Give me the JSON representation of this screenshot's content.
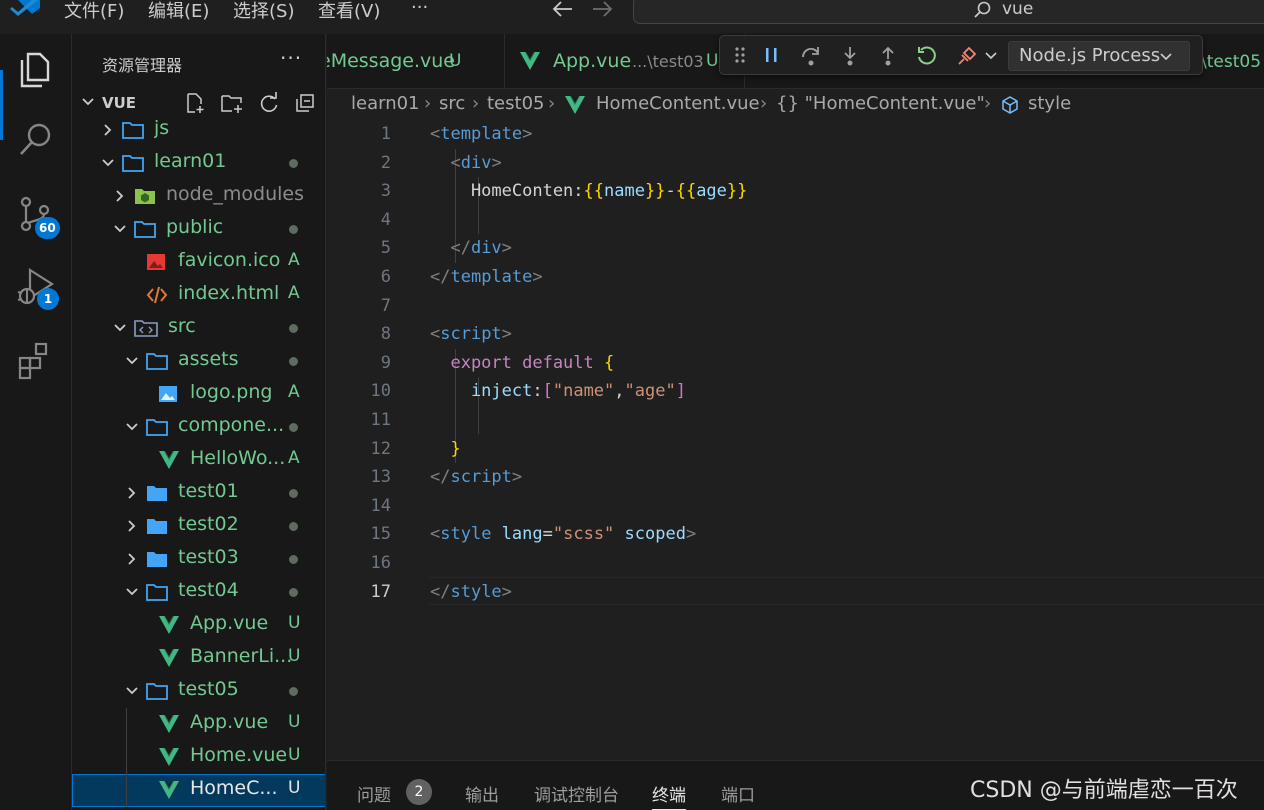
{
  "titlebar": {
    "menu": [
      "文件(F)",
      "编辑(E)",
      "选择(S)",
      "查看(V)",
      "···"
    ],
    "search": "vue",
    "icons": [
      "vscode-logo",
      "arrow-left-icon",
      "arrow-right-icon",
      "search-icon"
    ]
  },
  "activity_bar": {
    "items": [
      {
        "name": "explorer",
        "icon": "files-icon",
        "active": true
      },
      {
        "name": "search",
        "icon": "search-icon"
      },
      {
        "name": "source-control",
        "icon": "source-control-icon",
        "badge": "60"
      },
      {
        "name": "run-and-debug",
        "icon": "debug-icon",
        "badge": "1"
      },
      {
        "name": "extensions",
        "icon": "extensions-icon"
      }
    ],
    "accent": "#0078d4"
  },
  "sidebar": {
    "title": "资源管理器",
    "more": "···",
    "section": "VUE",
    "actions": [
      "new-file-icon",
      "new-folder-icon",
      "refresh-icon",
      "collapse-all-icon"
    ],
    "tree": [
      {
        "label": "js",
        "kind": "folder",
        "open": false,
        "depth": 1,
        "status": ""
      },
      {
        "label": "learn01",
        "kind": "folder",
        "open": true,
        "depth": 1,
        "status": "dot"
      },
      {
        "label": "node_modules",
        "kind": "node",
        "open": false,
        "depth": 2,
        "status": ""
      },
      {
        "label": "public",
        "kind": "folder",
        "open": true,
        "depth": 2,
        "status": "dot"
      },
      {
        "label": "favicon.ico",
        "kind": "ico",
        "depth": 3,
        "status": "A"
      },
      {
        "label": "index.html",
        "kind": "html",
        "depth": 3,
        "status": "A"
      },
      {
        "label": "src",
        "kind": "src",
        "open": true,
        "depth": 2,
        "status": "dot"
      },
      {
        "label": "assets",
        "kind": "folder",
        "open": true,
        "depth": 3,
        "status": "dot"
      },
      {
        "label": "logo.png",
        "kind": "png",
        "depth": 4,
        "status": "A"
      },
      {
        "label": "compone...",
        "kind": "folder",
        "open": true,
        "depth": 3,
        "status": "dot"
      },
      {
        "label": "HelloWo...",
        "kind": "vue",
        "depth": 4,
        "status": "A"
      },
      {
        "label": "test01",
        "kind": "folder-closed",
        "open": false,
        "depth": 3,
        "status": "dot"
      },
      {
        "label": "test02",
        "kind": "folder-closed",
        "open": false,
        "depth": 3,
        "status": "dot"
      },
      {
        "label": "test03",
        "kind": "folder-closed",
        "open": false,
        "depth": 3,
        "status": "dot"
      },
      {
        "label": "test04",
        "kind": "folder",
        "open": true,
        "depth": 3,
        "status": "dot"
      },
      {
        "label": "App.vue",
        "kind": "vue",
        "depth": 4,
        "status": "U"
      },
      {
        "label": "BannerLi...",
        "kind": "vue",
        "depth": 4,
        "status": "U"
      },
      {
        "label": "test05",
        "kind": "folder",
        "open": true,
        "depth": 3,
        "status": "dot"
      },
      {
        "label": "App.vue",
        "kind": "vue",
        "depth": 4,
        "status": "U"
      },
      {
        "label": "Home.vue",
        "kind": "vue",
        "depth": 4,
        "status": "U"
      },
      {
        "label": "HomeC...",
        "kind": "vue",
        "depth": 4,
        "status": "U",
        "selected": true
      }
    ]
  },
  "tabs": [
    {
      "label": "eMessage.vue",
      "path": "",
      "status": "U"
    },
    {
      "label": "App.vue",
      "path": "...\\test03",
      "status": "U"
    },
    {
      "label": "",
      "path": "\\test05",
      "status": ""
    }
  ],
  "debug_toolbar": {
    "icons": [
      "gripper-icon",
      "pause-icon",
      "step-over-icon",
      "step-into-icon",
      "step-out-icon",
      "restart-icon",
      "disconnect-icon",
      "chevron-down-icon"
    ],
    "process": "Node.js Process"
  },
  "breadcrumbs": [
    "learn01",
    "src",
    "test05",
    "HomeContent.vue",
    "{} \"HomeContent.vue\"",
    "style"
  ],
  "editor": {
    "current_line": 17,
    "lines": [
      [
        [
          "<",
          "#808080"
        ],
        [
          "template",
          "#569cd6"
        ],
        [
          ">",
          "#808080"
        ]
      ],
      [
        [
          "  <",
          "#808080"
        ],
        [
          "div",
          "#569cd6"
        ],
        [
          ">",
          "#808080"
        ]
      ],
      [
        [
          "    HomeConten:",
          "#d4d4d4"
        ],
        [
          "{{",
          "#ffd700"
        ],
        [
          "name",
          "#9cdcfe"
        ],
        [
          "}}",
          "#ffd700"
        ],
        [
          "-",
          "#d4d4d4"
        ],
        [
          "{{",
          "#ffd700"
        ],
        [
          "age",
          "#9cdcfe"
        ],
        [
          "}}",
          "#ffd700"
        ]
      ],
      [],
      [
        [
          "  </",
          "#808080"
        ],
        [
          "div",
          "#569cd6"
        ],
        [
          ">",
          "#808080"
        ]
      ],
      [
        [
          "</",
          "#808080"
        ],
        [
          "template",
          "#569cd6"
        ],
        [
          ">",
          "#808080"
        ]
      ],
      [],
      [
        [
          "<",
          "#808080"
        ],
        [
          "script",
          "#569cd6"
        ],
        [
          ">",
          "#808080"
        ]
      ],
      [
        [
          "  export default ",
          "#c586c0"
        ],
        [
          "{",
          "#ffd700"
        ]
      ],
      [
        [
          "    inject",
          "#9cdcfe"
        ],
        [
          ":",
          "#d4d4d4"
        ],
        [
          "[",
          "#da70d6"
        ],
        [
          "\"name\"",
          "#ce9178"
        ],
        [
          ",",
          "#d4d4d4"
        ],
        [
          "\"age\"",
          "#ce9178"
        ],
        [
          "]",
          "#da70d6"
        ]
      ],
      [],
      [
        [
          "  }",
          "#ffd700"
        ]
      ],
      [
        [
          "</",
          "#808080"
        ],
        [
          "script",
          "#569cd6"
        ],
        [
          ">",
          "#808080"
        ]
      ],
      [],
      [
        [
          "<",
          "#808080"
        ],
        [
          "style ",
          "#569cd6"
        ],
        [
          "lang",
          "#9cdcfe"
        ],
        [
          "=",
          "#d4d4d4"
        ],
        [
          "\"scss\"",
          "#ce9178"
        ],
        [
          " scoped",
          "#9cdcfe"
        ],
        [
          ">",
          "#808080"
        ]
      ],
      [],
      [
        [
          "</",
          "#808080"
        ],
        [
          "style",
          "#569cd6"
        ],
        [
          ">",
          "#808080"
        ]
      ]
    ]
  },
  "panel": {
    "tabs": [
      "问题",
      "输出",
      "调试控制台",
      "终端",
      "端口"
    ],
    "problems_count": "2",
    "active": "终端"
  },
  "watermark": "CSDN @与前端虐恋一百次",
  "colors": {
    "vue_green": "#41b883",
    "folder_blue": "#42a5f5",
    "added_green": "#73c991",
    "untracked_green": "#73c991"
  }
}
